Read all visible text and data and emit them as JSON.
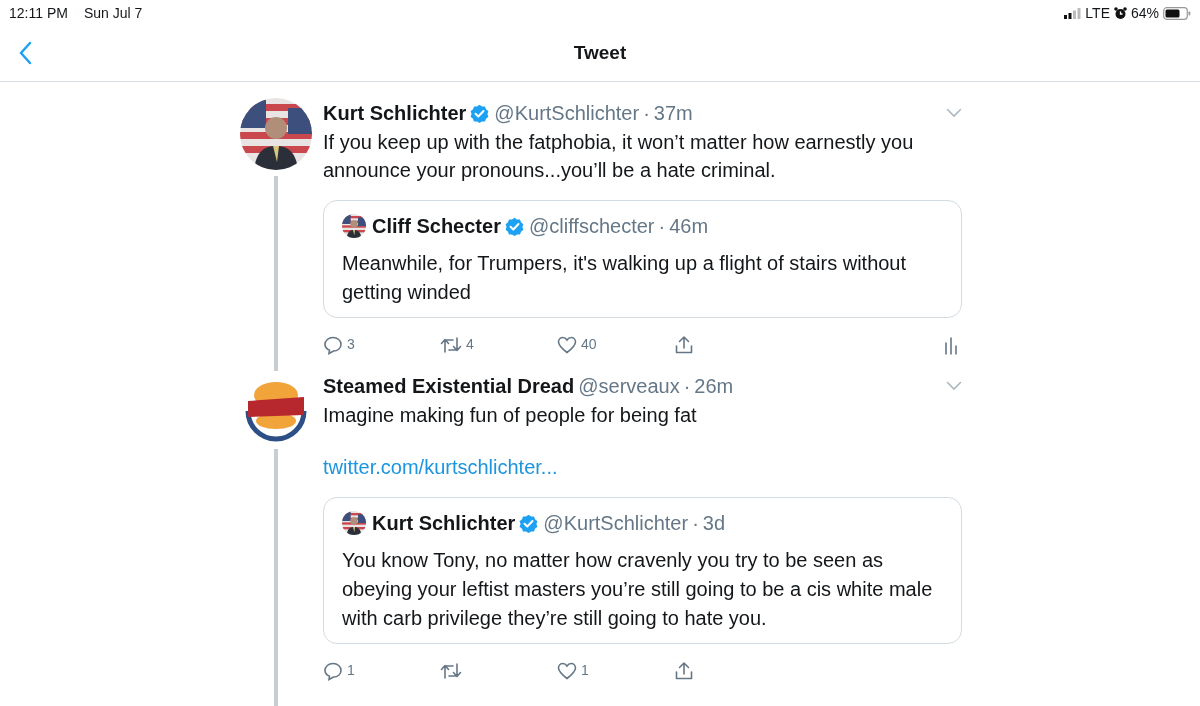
{
  "status_bar": {
    "time": "12:11 PM",
    "date": "Sun Jul 7",
    "network": "LTE",
    "battery": "64%"
  },
  "nav": {
    "title": "Tweet"
  },
  "tweets": [
    {
      "name": "Kurt Schlichter",
      "verified": true,
      "handle": "@KurtSchlichter",
      "sep": "·",
      "time": "37m",
      "text": "If you keep up with the fatphobia, it won’t matter how earnestly you announce your pronouns...you’ll be a hate criminal.",
      "quote": {
        "name": "Cliff Schecter",
        "verified": true,
        "handle": "@cliffschecter",
        "sep": "·",
        "time": "46m",
        "text": "Meanwhile, for Trumpers, it's walking up a flight of stairs without getting winded"
      },
      "actions": {
        "replies": "3",
        "retweets": "4",
        "likes": "40"
      },
      "analytics": true
    },
    {
      "kind": "logo",
      "name": "Steamed Existential Dread",
      "verified": false,
      "handle": "@serveaux",
      "sep": "·",
      "time": "26m",
      "text": "Imagine making fun of people for being fat",
      "link": "twitter.com/kurtschlichter...",
      "quote": {
        "name": "Kurt Schlichter",
        "verified": true,
        "handle": "@KurtSchlichter",
        "sep": "·",
        "time": "3d",
        "text": "You know Tony, no matter how cravenly you try to be seen as obeying your leftist masters you’re still going to be a cis white male with carb privilege they’re still going to hate you."
      },
      "actions": {
        "replies": "1",
        "likes": "1"
      },
      "analytics": false
    }
  ]
}
